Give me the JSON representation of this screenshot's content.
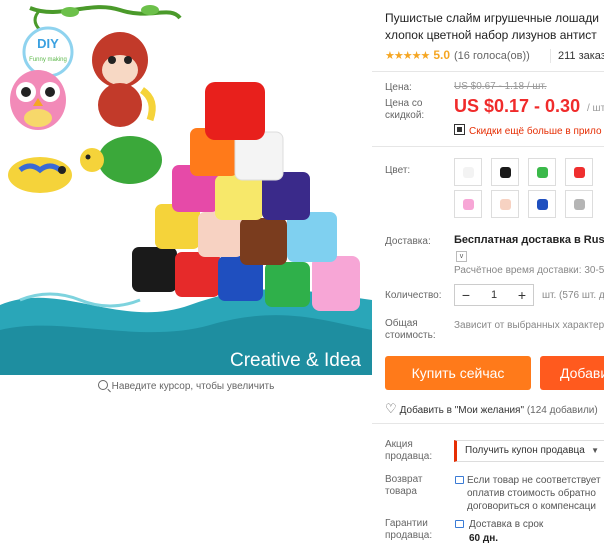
{
  "product_image": {
    "banner_text": "Creative & Idea",
    "badge_text": "DIY",
    "badge_sub": "Funny making",
    "zoom_hint": "Наведите курсор, чтобы увеличить"
  },
  "product": {
    "title_line1": "Пушистые слайм игрушечные лошади",
    "title_line2": "хлопок цветной набор лизунов антист",
    "stars": "★★★★★",
    "rating": "5.0",
    "votes": "(16 голоса(ов))",
    "orders": "211 заказ"
  },
  "price": {
    "label_price": "Цена:",
    "old_price": "US $0.67 - 1.18 / шт.",
    "label_discount": "Цена со скидкой:",
    "new_price": "US $0.17 - 0.30",
    "unit": "/ шт",
    "promo": "Скидки ещё больше в прило"
  },
  "color": {
    "label": "Цвет:",
    "swatches": [
      "#f3f3f3",
      "#1a1a1a",
      "#3bb94a",
      "#ef2f2f",
      "#f7a6d6",
      "#f7d2c2",
      "#1f4fbf",
      "#b5b5b5"
    ]
  },
  "delivery": {
    "label": "Доставка:",
    "text": "Бесплатная доставка в Russian",
    "chevron": "v",
    "time": "Расчётное время доставки: 30-5"
  },
  "quantity": {
    "label": "Количество:",
    "minus": "−",
    "value": "1",
    "plus": "+",
    "unit": "шт. (576 шт. д"
  },
  "total": {
    "label": "Общая стоимость:",
    "text": "Зависит от выбранных характер"
  },
  "actions": {
    "buy": "Купить сейчас",
    "add": "Добави"
  },
  "wishlist": {
    "text": "Добавить в \"Мои желания\"",
    "count": "(124 добавили)"
  },
  "seller": {
    "promo_label": "Акция продавца:",
    "coupon": "Получить купон продавца",
    "return_label": "Возврат товара",
    "return_line1": "Если товар не соответствует",
    "return_line2": "оплатив стоимость обратно",
    "return_line3": "договориться о компенсаци",
    "guarantee_label": "Гарантии продавца:",
    "guarantee_line1": "Доставка в срок",
    "guarantee_line2": "60 дн."
  }
}
